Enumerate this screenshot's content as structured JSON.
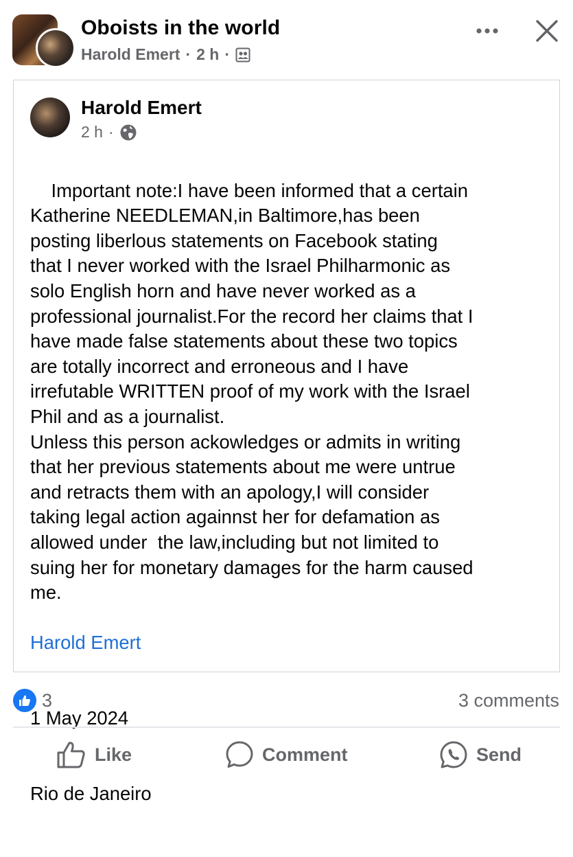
{
  "header": {
    "group_name": "Oboists in the world",
    "author": "Harold Emert",
    "separator": "·",
    "time": "2 h",
    "privacy_icon": "members-icon",
    "more_icon": "more-horizontal-icon",
    "close_icon": "close-icon"
  },
  "shared_post": {
    "author": "Harold Emert",
    "time": "2 h",
    "separator": "·",
    "privacy_icon": "globe-icon",
    "body": "Important note:I have been informed that a certain\nKatherine NEEDLEMAN,in Baltimore,has been\nposting liberlous statements on Facebook stating\nthat I never worked with the Israel Philharmonic as\nsolo English horn and have never worked as a\nprofessional journalist.For the record her claims that I\nhave made false statements about these two topics\nare totally incorrect and erroneous and I have\nirrefutable WRITTEN proof of my work with the Israel\nPhil and as a journalist.\nUnless this person ackowledges or admits in writing\nthat her previous statements about me were untrue\nand retracts them with an apology,I will consider\ntaking legal action againnst her for defamation as\nallowed under  the law,including but not limited to\nsuing her for monetary damages for the harm caused\nme.",
    "signature_link": "Harold Emert",
    "signature_date": "1 May 2024",
    "signature_place": "Rio de Janeiro"
  },
  "reactions": {
    "icon": "like-reaction-icon",
    "count": "3",
    "comments": "3 comments"
  },
  "actions": {
    "like": "Like",
    "comment": "Comment",
    "send": "Send"
  },
  "colors": {
    "link_blue": "#1f6fd6",
    "like_blue": "#1877f2",
    "secondary_text": "#65676b"
  }
}
